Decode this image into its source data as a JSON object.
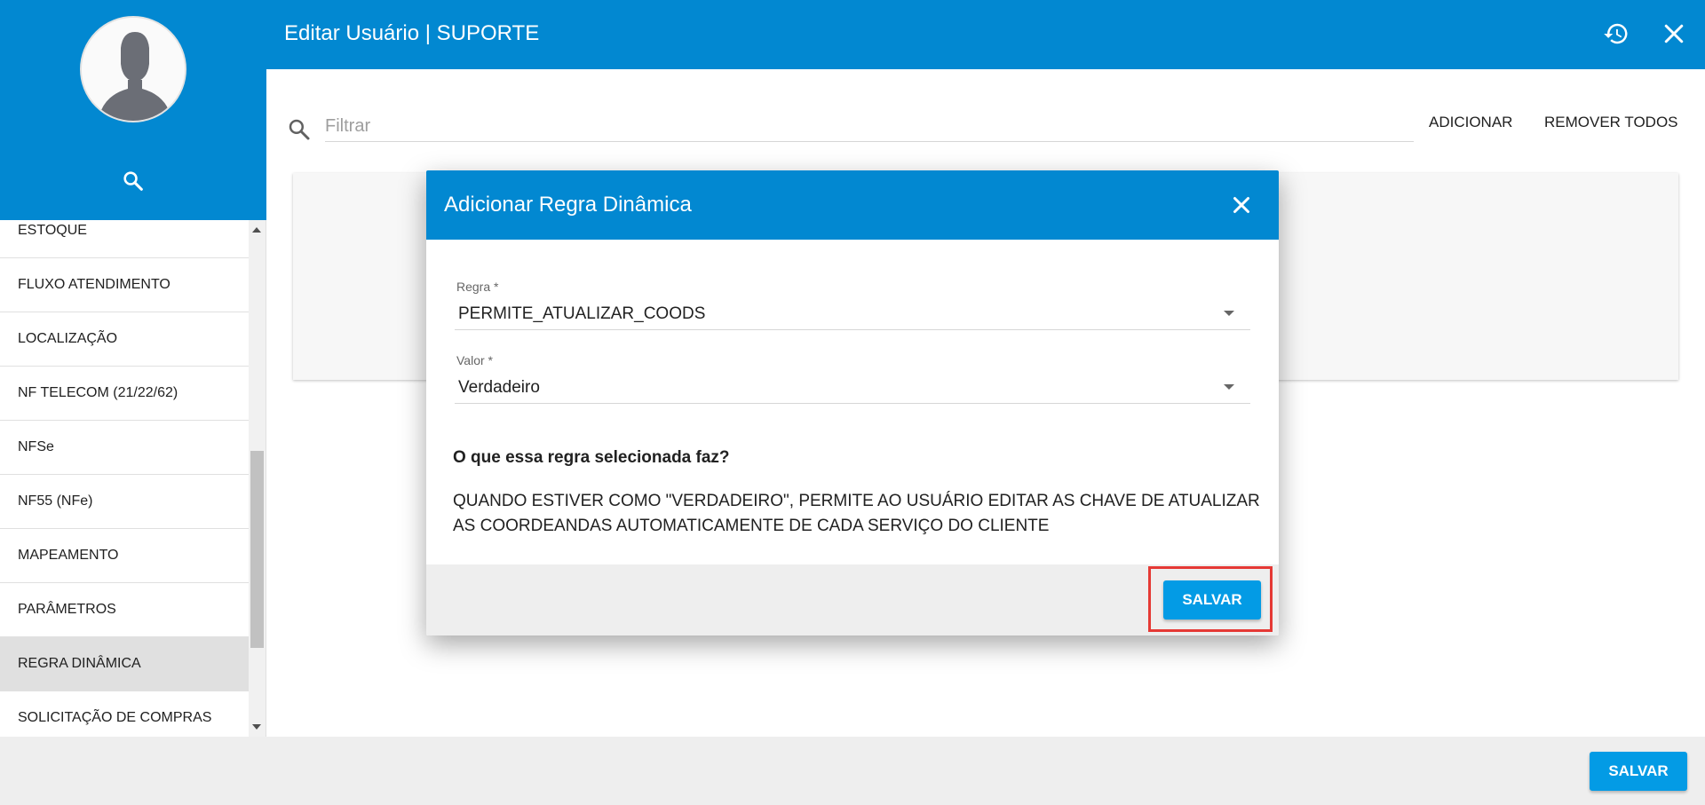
{
  "header": {
    "title": "Editar Usuário | SUPORTE",
    "icons": [
      "history-icon",
      "close-icon"
    ]
  },
  "sidebar": {
    "items": [
      {
        "label": "ESTOQUE"
      },
      {
        "label": "FLUXO ATENDIMENTO"
      },
      {
        "label": "LOCALIZAÇÃO"
      },
      {
        "label": "NF TELECOM (21/22/62)"
      },
      {
        "label": "NFSe"
      },
      {
        "label": "NF55 (NFe)"
      },
      {
        "label": "MAPEAMENTO"
      },
      {
        "label": "PARÂMETROS"
      },
      {
        "label": "REGRA DINÂMICA",
        "active": true
      },
      {
        "label": "SOLICITAÇÃO DE COMPRAS"
      }
    ]
  },
  "filter": {
    "placeholder": "Filtrar",
    "value": "",
    "add_label": "ADICIONAR",
    "remove_all_label": "REMOVER TODOS"
  },
  "dialog": {
    "title": "Adicionar Regra Dinâmica",
    "rule_label": "Regra *",
    "rule_value": "PERMITE_ATUALIZAR_COODS",
    "value_label": "Valor *",
    "value_value": "Verdadeiro",
    "question": "O que essa regra selecionada faz?",
    "description": "QUANDO ESTIVER COMO \"VERDADEIRO\", PERMITE AO USUÁRIO EDITAR AS CHAVE DE ATUALIZAR AS COORDEANDAS AUTOMATICAMENTE DE CADA SERVIÇO DO CLIENTE",
    "save_label": "SALVAR"
  },
  "footer": {
    "save_label": "SALVAR"
  },
  "colors": {
    "primary": "#0288d1",
    "button": "#039be5",
    "highlight": "#e53935",
    "active_item": "#e0e0e0"
  }
}
